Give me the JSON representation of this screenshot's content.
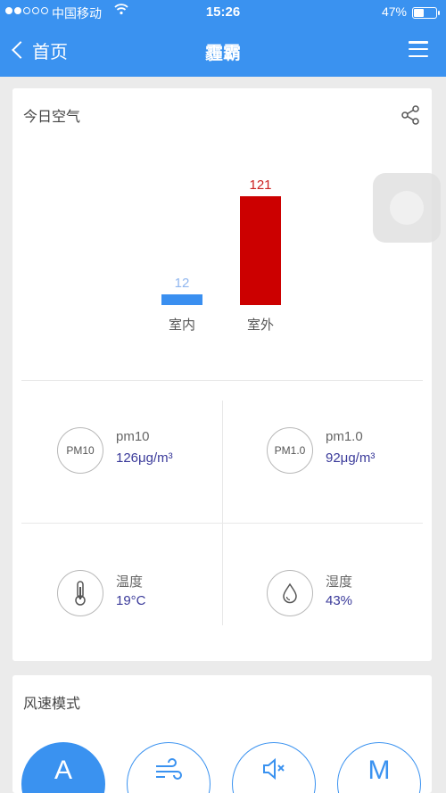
{
  "status_bar": {
    "carrier": "中国移动",
    "time": "15:26",
    "battery_text": "47%",
    "battery_level": 0.47
  },
  "nav": {
    "back_label": "首页",
    "title": "霾霸"
  },
  "air_card": {
    "heading": "今日空气",
    "chart_data": {
      "type": "bar",
      "categories": [
        "室内",
        "室外"
      ],
      "values": [
        12,
        121
      ],
      "colors": [
        "#3a8ff0",
        "#cc0000"
      ],
      "value_colors": [
        "#8fb6ef",
        "#cc2222"
      ],
      "ylim": [
        0,
        121
      ]
    },
    "metrics": [
      {
        "icon_text": "PM10",
        "icon": "pm10-icon",
        "name": "pm10",
        "value": "126μg/m³"
      },
      {
        "icon_text": "PM1.0",
        "icon": "pm1-icon",
        "name": "pm1.0",
        "value": "92μg/m³"
      },
      {
        "icon": "thermometer-icon",
        "name": "温度",
        "value": "19°C"
      },
      {
        "icon": "water-drop-icon",
        "name": "湿度",
        "value": "43%"
      }
    ]
  },
  "mode_card": {
    "heading": "风速模式",
    "modes": [
      {
        "label": "A",
        "icon": "auto-mode-icon",
        "active": true
      },
      {
        "label": "",
        "icon": "wind-mode-icon",
        "active": false
      },
      {
        "label": "",
        "icon": "mute-mode-icon",
        "active": false
      },
      {
        "label": "M",
        "icon": "manual-mode-icon",
        "active": false
      }
    ]
  },
  "colors": {
    "accent": "#3a92f0",
    "outdoor_bar": "#cc0000",
    "indoor_bar": "#3a8ff0",
    "value_text": "#3a3a9a"
  }
}
